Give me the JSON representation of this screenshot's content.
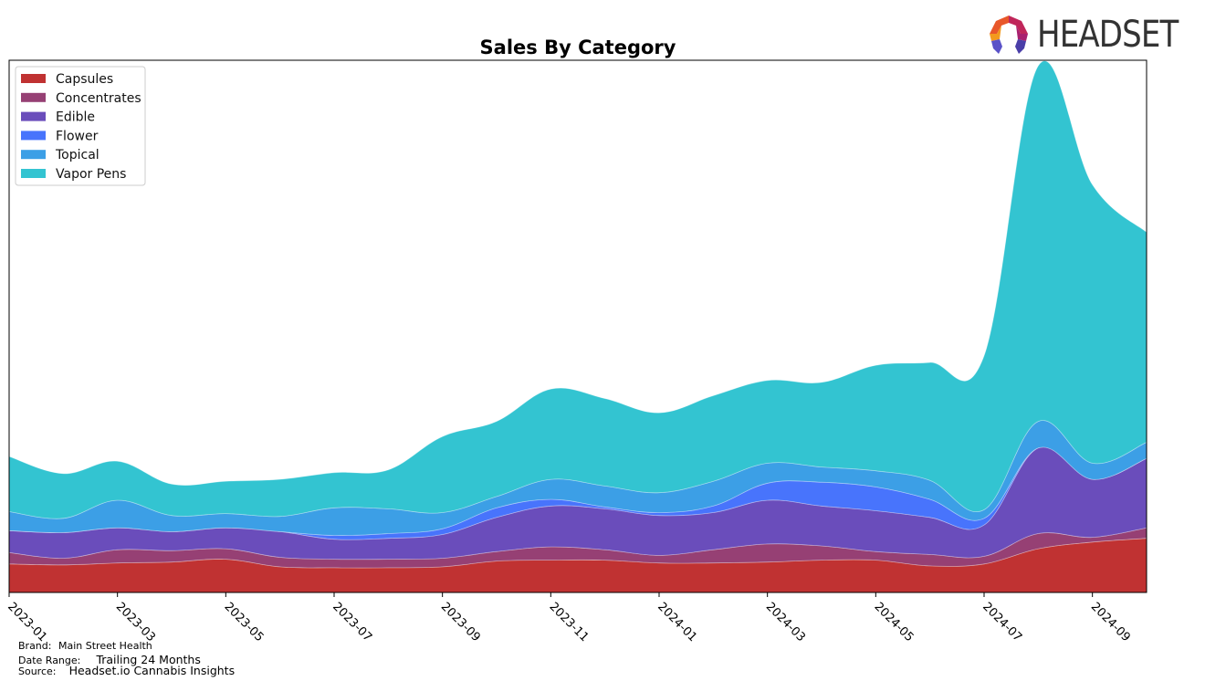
{
  "logo": {
    "text": "HEADSET"
  },
  "footer": {
    "brand_label": "Brand:",
    "brand_value": "Main Street Health",
    "date_range_label": "Date Range:",
    "date_range_value": "Trailing 24 Months",
    "source_label": "Source:",
    "source_value": "Headset.io Cannabis Insights"
  },
  "chart_data": {
    "type": "area",
    "stacked": true,
    "title": "Sales By Category",
    "xlabel": "",
    "ylabel": "",
    "y_units": "relative (no y-axis labels shown)",
    "ylim": [
      0,
      560
    ],
    "grid": false,
    "legend_position": "top-left",
    "x": [
      "2023-01",
      "2023-02",
      "2023-03",
      "2023-04",
      "2023-05",
      "2023-06",
      "2023-07",
      "2023-08",
      "2023-09",
      "2023-10",
      "2023-11",
      "2023-12",
      "2024-01",
      "2024-02",
      "2024-03",
      "2024-04",
      "2024-05",
      "2024-06",
      "2024-07",
      "2024-08",
      "2024-09",
      "2024-10"
    ],
    "x_ticks": [
      "2023-01",
      "2023-03",
      "2023-05",
      "2023-07",
      "2023-09",
      "2023-11",
      "2024-01",
      "2024-03",
      "2024-05",
      "2024-07",
      "2024-09"
    ],
    "series": [
      {
        "name": "Capsules",
        "color": "#c03232",
        "values": [
          30,
          29,
          31,
          32,
          35,
          27,
          26,
          26,
          27,
          33,
          34,
          34,
          31,
          31,
          32,
          34,
          34,
          28,
          30,
          46,
          53,
          57
        ]
      },
      {
        "name": "Concentrates",
        "color": "#964074",
        "values": [
          12,
          7,
          14,
          12,
          11,
          10,
          9,
          9,
          9,
          10,
          14,
          11,
          8,
          14,
          19,
          15,
          9,
          12,
          8,
          16,
          5,
          11
        ]
      },
      {
        "name": "Edible",
        "color": "#6a4dbb",
        "values": [
          23,
          27,
          23,
          20,
          22,
          27,
          21,
          22,
          25,
          36,
          43,
          43,
          42,
          39,
          46,
          42,
          43,
          39,
          33,
          90,
          61,
          73
        ]
      },
      {
        "name": "Flower",
        "color": "#4874fc",
        "values": [
          0,
          0,
          0,
          0,
          0,
          0,
          4,
          5,
          6,
          10,
          7,
          2,
          3,
          7,
          18,
          25,
          25,
          19,
          7,
          0,
          0,
          0
        ]
      },
      {
        "name": "Topical",
        "color": "#3c9fe6",
        "values": [
          20,
          15,
          29,
          17,
          15,
          16,
          29,
          26,
          17,
          12,
          21,
          22,
          21,
          26,
          21,
          16,
          17,
          20,
          9,
          28,
          17,
          17
        ]
      },
      {
        "name": "Vapor Pens",
        "color": "#33c4d1",
        "values": [
          58,
          47,
          41,
          33,
          34,
          39,
          37,
          41,
          80,
          79,
          95,
          92,
          84,
          90,
          87,
          89,
          111,
          124,
          162,
          374,
          293,
          221
        ]
      }
    ]
  }
}
